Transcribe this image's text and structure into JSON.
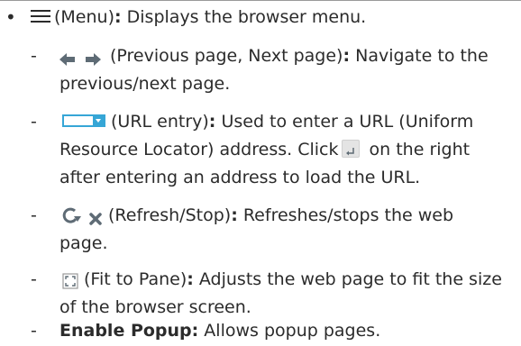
{
  "items": {
    "menu": {
      "bullet": "•",
      "icon": "menu-icon",
      "name": "(Menu)",
      "colon": ":",
      "desc": " Displays the browser menu."
    },
    "nav": {
      "dash": "-",
      "icons": [
        "previous-page-icon",
        "next-page-icon"
      ],
      "name": "(Previous page, Next page)",
      "colon": ":",
      "desc1": " Navigate to the",
      "desc2": "previous/next page."
    },
    "url": {
      "dash": "-",
      "icon": "url-entry-icon",
      "name": "(URL entry)",
      "colon": ":",
      "desc1": " Used to enter a URL (Uniform",
      "desc2": "Resource Locator) address. Click",
      "enter_icon": "enter-icon",
      "desc2b": " on the right",
      "desc3": "after entering an address to load the URL."
    },
    "refresh": {
      "dash": "-",
      "icons": [
        "refresh-icon",
        "stop-icon"
      ],
      "name": "(Refresh/Stop)",
      "colon": ":",
      "desc1": " Refreshes/stops the web",
      "desc2": "page."
    },
    "fit": {
      "dash": "-",
      "icon": "fit-to-pane-icon",
      "name": "(Fit to Pane)",
      "colon": ":",
      "desc1": " Adjusts the web page to fit the size",
      "desc2": "of the browser screen."
    },
    "popup": {
      "dash": "-",
      "name": "Enable Popup:",
      "desc": " Allows popup pages."
    }
  },
  "colors": {
    "text": "#2b2b2b",
    "accent_blue": "#36a6d6",
    "icon_gray": "#5e6b75"
  }
}
